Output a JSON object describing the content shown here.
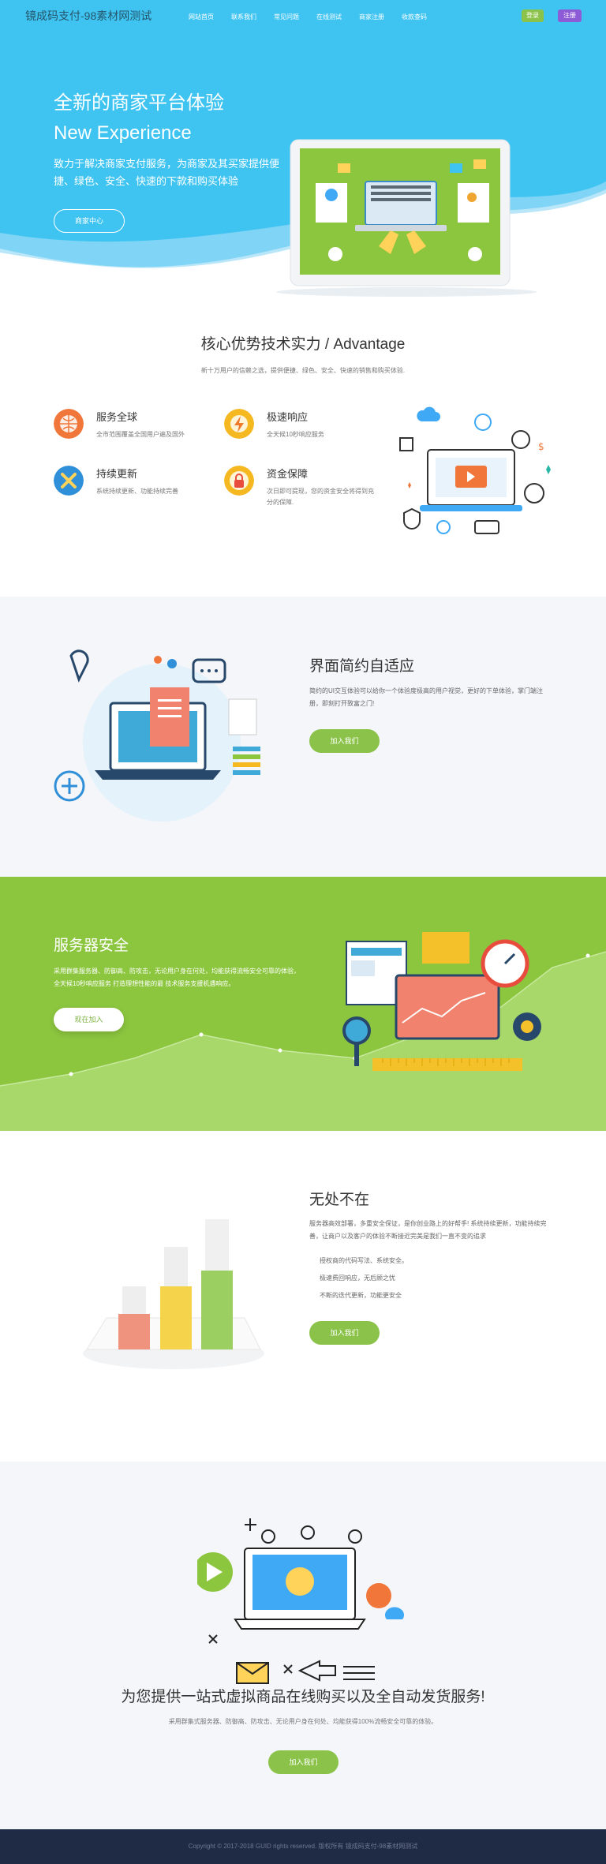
{
  "brand": "镜成码支付-98素材网测试",
  "nav": [
    "网站首页",
    "联系我们",
    "常见问题",
    "在线测试",
    "商家注册",
    "收款查码"
  ],
  "auth": {
    "login": "登录",
    "register": "注册"
  },
  "hero": {
    "title": "全新的商家平台体验",
    "subtitle": "New Experience",
    "desc": "致力于解决商家支付服务，为商家及其买家提供便捷、绿色、安全、快速的下款和购买体验",
    "button": "商家中心"
  },
  "advantage": {
    "title": "核心优势技术实力 / Advantage",
    "desc": "新十万用户的信赖之选，提供便捷、绿色、安全、快速的销售和购买体验.",
    "features": [
      {
        "title": "服务全球",
        "desc": "全市范围覆盖全国用户遍及国外",
        "icon": "globe-icon",
        "color": "#f0763a"
      },
      {
        "title": "极速响应",
        "desc": "全天候10秒响应服务",
        "icon": "lightning-icon",
        "color": "#f5b820"
      },
      {
        "title": "持续更新",
        "desc": "系统持续更新、功能持续完善",
        "icon": "tools-icon",
        "color": "#2f8fd8"
      },
      {
        "title": "资金保障",
        "desc": "次日即可提现，您的资金安全将得到充分的保障.",
        "icon": "lock-icon",
        "color": "#f5b820"
      }
    ]
  },
  "ui_section": {
    "title": "界面简约自适应",
    "desc": "简约的UI交互体验可以给你一个体验度极高的用户视觉，更好的下单体验，掌门端注册，即刻打开致富之门!",
    "button": "加入我们"
  },
  "server_section": {
    "title": "服务器安全",
    "desc": "采用群集服务器、防御高、防攻击，无论用户身在何处，均能获得流畅安全可靠的体验，全天候10秒响应服务 打造理想性能的最 技术服务支援机遇响应。",
    "button": "现在加入"
  },
  "everywhere_section": {
    "title": "无处不在",
    "desc": "服务器高效部署，多重安全保证，是你创业路上的好帮手! 系统持续更新，功能持续完善，让商户以及客户的体验不断接近完美是我们一直不变的追求",
    "items": [
      "授权商的代码写法、系统安全。",
      "极速费回响应，无后顾之忧",
      "不断的迭代更新，功能更安全"
    ],
    "button": "加入我们"
  },
  "onestop_section": {
    "title": "为您提供一站式虚拟商品在线购买以及全自动发货服务!",
    "desc": "采用群集式服务器、防御高、防攻击、无论用户身在何处、均能获得100%流畅安全可靠的体验。",
    "button": "加入我们"
  },
  "footer": "Copyright © 2017-2018 GUID rights reserved. 版权所有 镜成码支付-98素材网测试",
  "colors": {
    "hero_blue": "#3fc4f2",
    "green": "#8bc34a",
    "purple": "#8e5bd6",
    "footer": "#1f2a44"
  }
}
